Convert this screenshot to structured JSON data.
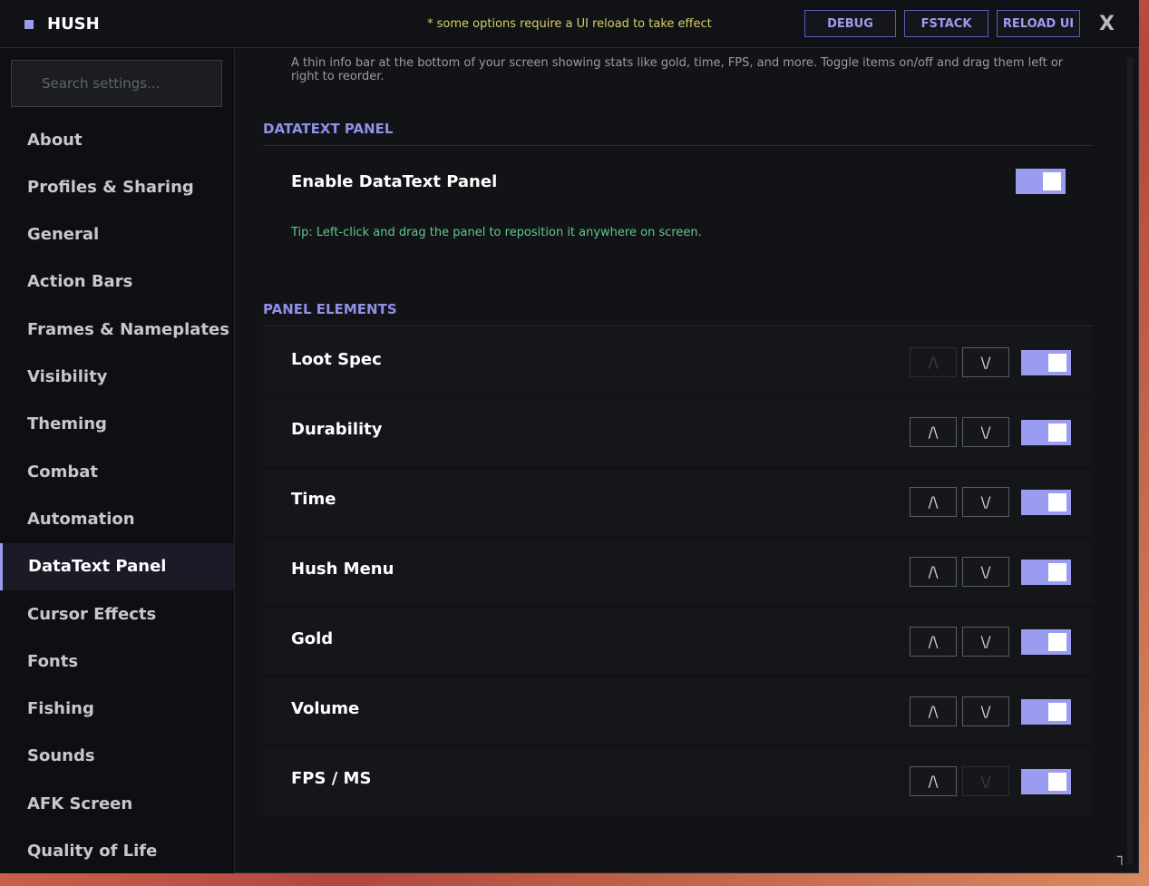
{
  "titlebar": {
    "app_name": "HUSH",
    "reload_note": "* some options require a UI reload to take effect",
    "buttons": {
      "debug": "DEBUG",
      "fstack": "FSTACK",
      "reload": "RELOAD UI"
    },
    "close_glyph": "X"
  },
  "sidebar": {
    "search_placeholder": "Search settings...",
    "items": [
      "About",
      "Profiles & Sharing",
      "General",
      "Action Bars",
      "Frames & Nameplates",
      "Visibility",
      "Theming",
      "Combat",
      "Automation",
      "DataText Panel",
      "Cursor Effects",
      "Fonts",
      "Fishing",
      "Sounds",
      "AFK Screen",
      "Quality of Life"
    ],
    "active_item": "DataText Panel"
  },
  "content": {
    "description": "A thin info bar at the bottom of your screen showing stats like gold, time, FPS, and more. Toggle items on/off and drag them left or right to reorder.",
    "datatext_section": {
      "header": "DATATEXT PANEL",
      "enable_label": "Enable DataText Panel",
      "enable_on": true,
      "tip": "Tip: Left-click and drag the panel to reposition it anywhere on screen."
    },
    "elements_section": {
      "header": "PANEL ELEMENTS",
      "up_glyph": "/\\",
      "down_glyph": "\\/",
      "items": [
        {
          "label": "Loot Spec",
          "enabled": true,
          "up_disabled": true,
          "down_disabled": false
        },
        {
          "label": "Durability",
          "enabled": true,
          "up_disabled": false,
          "down_disabled": false
        },
        {
          "label": "Time",
          "enabled": true,
          "up_disabled": false,
          "down_disabled": false
        },
        {
          "label": "Hush Menu",
          "enabled": true,
          "up_disabled": false,
          "down_disabled": false
        },
        {
          "label": "Gold",
          "enabled": true,
          "up_disabled": false,
          "down_disabled": false
        },
        {
          "label": "Volume",
          "enabled": true,
          "up_disabled": false,
          "down_disabled": false
        },
        {
          "label": "FPS / MS",
          "enabled": true,
          "up_disabled": false,
          "down_disabled": true
        }
      ]
    }
  },
  "colors": {
    "accent": "#9a9cf0",
    "tip": "#5fc98a",
    "note": "#d6cf6a"
  }
}
